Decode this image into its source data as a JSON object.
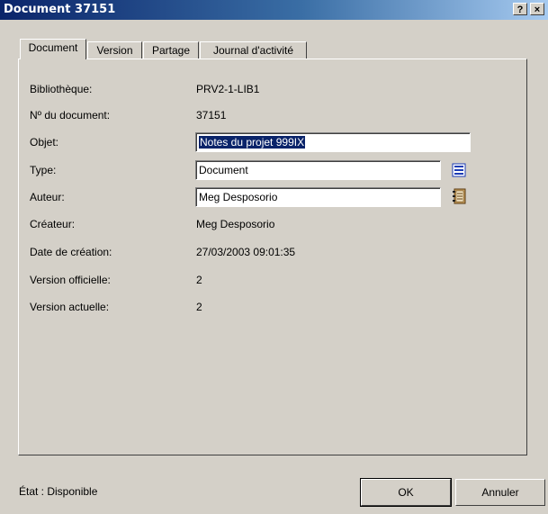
{
  "window": {
    "title": "Document 37151",
    "help_label": "?",
    "close_label": "×"
  },
  "tabs": [
    {
      "label": "Document",
      "active": true
    },
    {
      "label": "Version",
      "active": false
    },
    {
      "label": "Partage",
      "active": false
    },
    {
      "label": "Journal d'activité",
      "active": false
    }
  ],
  "fields": {
    "library": {
      "label": "Bibliothèque:",
      "value": "PRV2-1-LIB1"
    },
    "doc_number": {
      "label": "Nº du document:",
      "value": "37151"
    },
    "subject": {
      "label": "Objet:",
      "value": "Notes du projet 999IX"
    },
    "type": {
      "label": "Type:",
      "value": "Document",
      "button_icon": "list-icon"
    },
    "author": {
      "label": "Auteur:",
      "value": "Meg Desposorio",
      "button_icon": "address-book-icon"
    },
    "creator": {
      "label": "Créateur:",
      "value": "Meg Desposorio"
    },
    "creation_date": {
      "label": "Date de création:",
      "value": "27/03/2003 09:01:35"
    },
    "official_version": {
      "label": "Version officielle:",
      "value": "2"
    },
    "current_version": {
      "label": "Version actuelle:",
      "value": "2"
    }
  },
  "status": {
    "text": "État : Disponible"
  },
  "buttons": {
    "ok": "OK",
    "cancel": "Annuler"
  },
  "colors": {
    "title_bar": "#0a246a",
    "dialog_bg": "#d4d0c8",
    "selection": "#0a246a"
  }
}
